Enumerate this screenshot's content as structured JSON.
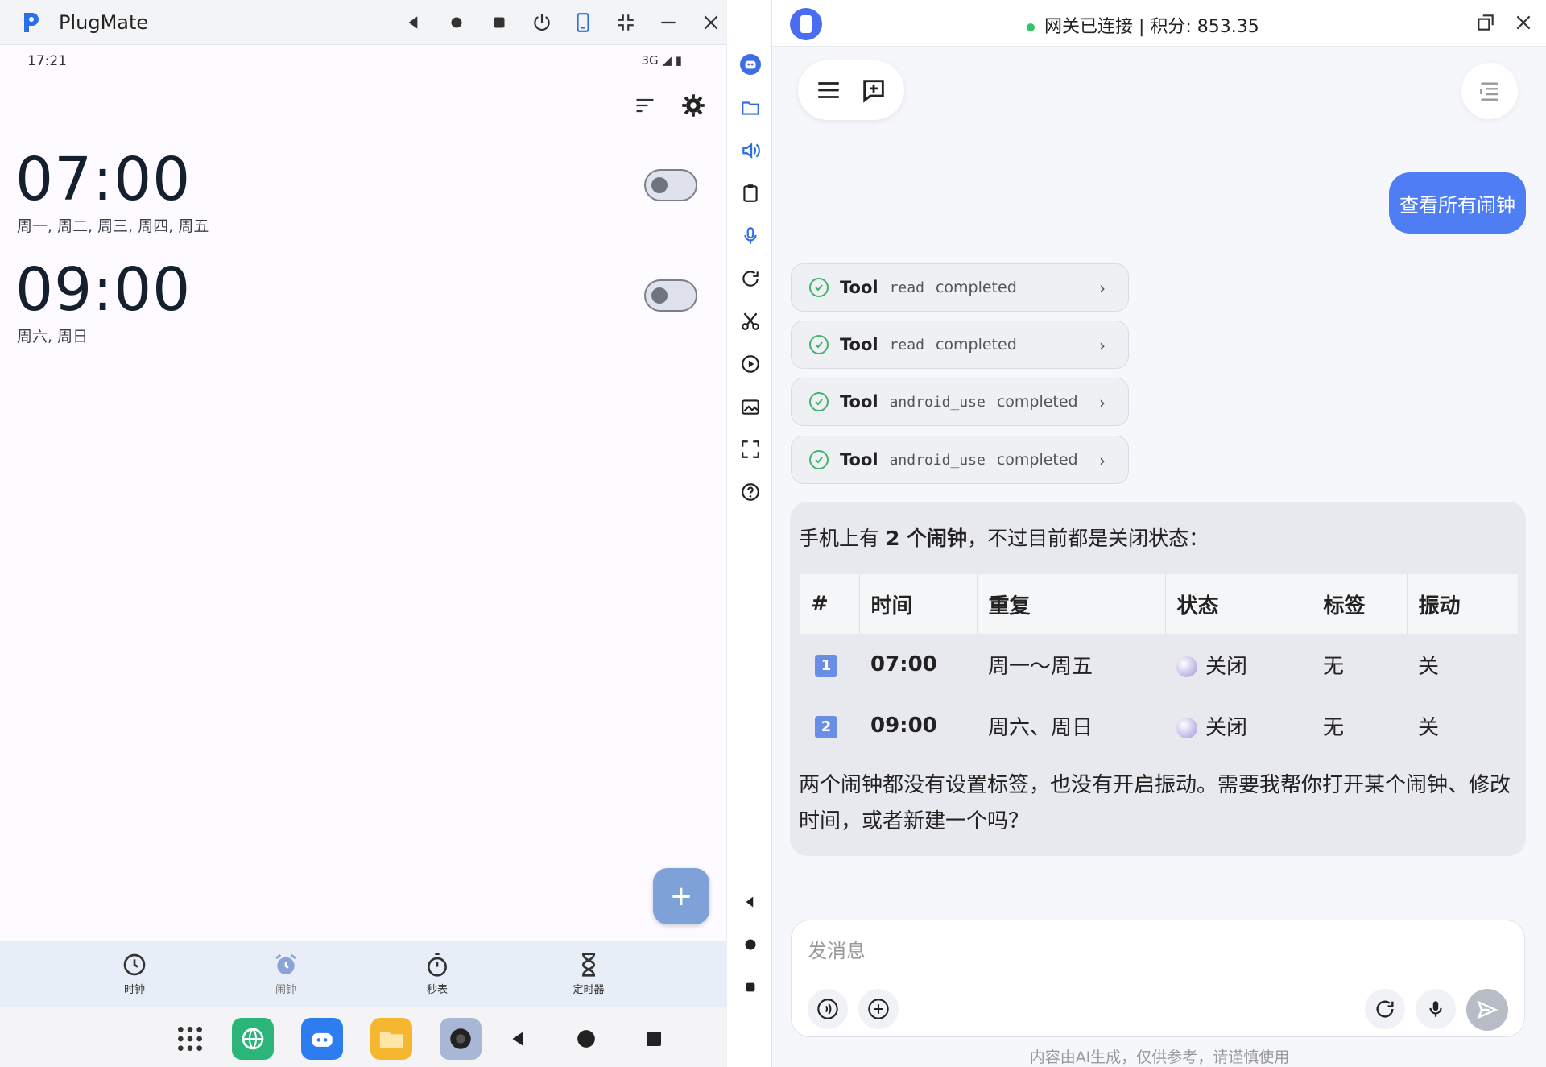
{
  "left_window": {
    "title": "PlugMate",
    "controls": [
      "back-icon",
      "record-icon",
      "stop-icon",
      "power-icon",
      "phone-icon",
      "compress-icon",
      "minimize-icon",
      "close-icon",
      "collapse-icon"
    ]
  },
  "phone": {
    "status_time": "17:21",
    "status_network": "3G",
    "alarms": [
      {
        "time": "07:00",
        "days": "周一, 周二, 周三, 周四, 周五",
        "enabled": false
      },
      {
        "time": "09:00",
        "days": "周六, 周日",
        "enabled": false
      }
    ],
    "fab_label": "+",
    "tabs": [
      {
        "label": "时钟",
        "icon": "clock-icon"
      },
      {
        "label": "闹钟",
        "icon": "alarm-icon",
        "active": true
      },
      {
        "label": "秒表",
        "icon": "stopwatch-icon"
      },
      {
        "label": "定时器",
        "icon": "hourglass-icon"
      }
    ]
  },
  "chat": {
    "status": "网关已连接 | 积分: 853.35",
    "user_message": "查看所有闹钟",
    "tool_label": "Tool",
    "tools": [
      {
        "name": "read",
        "status": "completed"
      },
      {
        "name": "read",
        "status": "completed"
      },
      {
        "name": "android_use",
        "status": "completed"
      },
      {
        "name": "android_use",
        "status": "completed"
      }
    ],
    "answer": {
      "intro_pre": "手机上有 ",
      "intro_bold": "2 个闹钟",
      "intro_post": "，不过目前都是关闭状态：",
      "table_headers": [
        "#",
        "时间",
        "重复",
        "状态",
        "标签",
        "振动"
      ],
      "rows": [
        {
          "n": "1",
          "time": "07:00",
          "repeat": "周一～周五",
          "state": "关闭",
          "tag": "无",
          "vibrate": "关"
        },
        {
          "n": "2",
          "time": "09:00",
          "repeat": "周六、周日",
          "state": "关闭",
          "tag": "无",
          "vibrate": "关"
        }
      ],
      "outro": "两个闹钟都没有设置标签，也没有开启振动。需要我帮你打开某个闹钟、修改时间，或者新建一个吗？"
    },
    "input_placeholder": "发消息",
    "disclaimer": "内容由AI生成，仅供参考，请谨慎使用"
  },
  "colors": {
    "accent": "#4f7df3",
    "fab": "#7ea2d8",
    "connected": "#36c26a"
  }
}
